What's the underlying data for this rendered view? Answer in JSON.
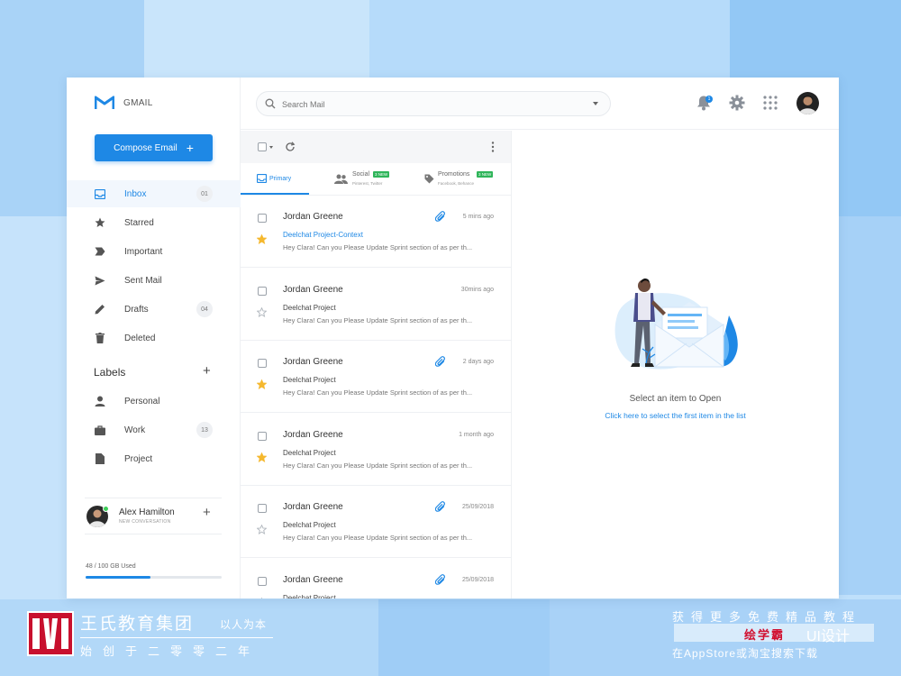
{
  "brand": {
    "name": "GMAIL",
    "compose_label": "Compose Email",
    "compose_plus": "+"
  },
  "nav": [
    {
      "label": "Inbox",
      "count": "01",
      "icon": "inbox-icon",
      "active": true
    },
    {
      "label": "Starred",
      "count": "",
      "icon": "star-icon"
    },
    {
      "label": "Important",
      "count": "",
      "icon": "label-icon"
    },
    {
      "label": "Sent Mail",
      "count": "",
      "icon": "send-icon"
    },
    {
      "label": "Drafts",
      "count": "04",
      "icon": "pencil-icon"
    },
    {
      "label": "Deleted",
      "count": "",
      "icon": "trash-icon"
    }
  ],
  "labels": {
    "title": "Labels",
    "add": "+",
    "items": [
      {
        "label": "Personal",
        "count": "",
        "icon": "person-icon"
      },
      {
        "label": "Work",
        "count": "13",
        "icon": "briefcase-icon"
      },
      {
        "label": "Project",
        "count": "",
        "icon": "document-icon"
      }
    ]
  },
  "user": {
    "name": "Alex Hamilton",
    "subtitle": "NEW CONVERSATION",
    "add": "+"
  },
  "storage": {
    "text": "48 / 100 GB Used",
    "used_fraction": 0.48
  },
  "search": {
    "placeholder": "Search Mail"
  },
  "notifications": {
    "count": "1"
  },
  "tabs": [
    {
      "label": "Primary",
      "badge": "",
      "sub": ""
    },
    {
      "label": "Social",
      "badge": "3 NEW",
      "sub": "Pinterest, Twitter"
    },
    {
      "label": "Promotions",
      "badge": "3 NEW",
      "sub": "Facebook, Behance"
    }
  ],
  "emails": [
    {
      "sender": "Jordan Greene",
      "time": "5 mins ago",
      "subject": "Deelchat Project-Context",
      "snippet": "Hey Clara! Can you Please Update Sprint section of as per th...",
      "starred": true,
      "attachment": true,
      "subject_highlight": true
    },
    {
      "sender": "Jordan Greene",
      "time": "30mins ago",
      "subject": "Deelchat Project",
      "snippet": "Hey Clara! Can you Please Update Sprint section of as per th...",
      "starred": false,
      "attachment": false
    },
    {
      "sender": "Jordan Greene",
      "time": "2 days ago",
      "subject": "Deelchat Project",
      "snippet": "Hey Clara! Can you Please Update Sprint section of as per th...",
      "starred": true,
      "attachment": true
    },
    {
      "sender": "Jordan Greene",
      "time": "1 month ago",
      "subject": "Deelchat Project",
      "snippet": "Hey Clara! Can you Please Update Sprint section of as per th...",
      "starred": true,
      "attachment": false
    },
    {
      "sender": "Jordan Greene",
      "time": "25/09/2018",
      "subject": "Deelchat Project",
      "snippet": "Hey Clara! Can you Please Update Sprint section of as per th...",
      "starred": false,
      "attachment": true
    },
    {
      "sender": "Jordan Greene",
      "time": "25/09/2018",
      "subject": "Deelchat Project",
      "snippet": "",
      "starred": false,
      "attachment": true
    }
  ],
  "preview": {
    "title": "Select an item to Open",
    "link": "Click here to select the first item in the list"
  },
  "footer": {
    "left_title": "王氏教育集团",
    "left_slogan": "以人为本",
    "left_since": "始创于二零零二年",
    "right_line1": "获得更多免费精品教程",
    "right_brand": "绘学霸",
    "right_ui": "UI设计",
    "right_line3": "在AppStore或淘宝搜索下载"
  },
  "colors": {
    "accent": "#1e88e5",
    "star": "#f5b82e",
    "badge_green": "#2fb55a",
    "background": "#bfe0fb"
  }
}
